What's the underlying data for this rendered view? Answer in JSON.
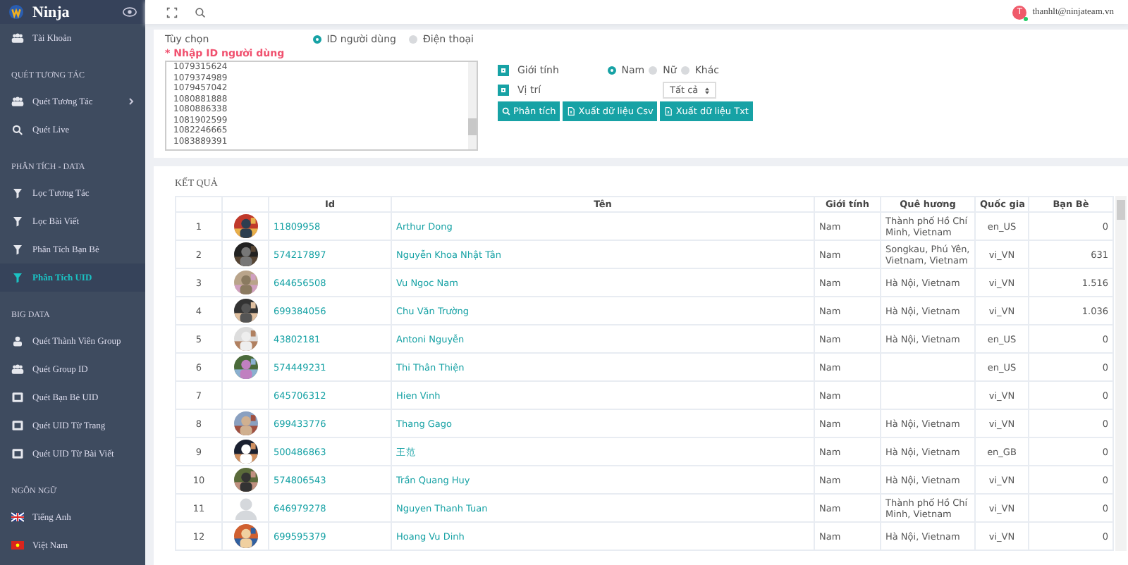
{
  "sidebar": {
    "brand": "Ninja",
    "groups": [
      {
        "items": [
          {
            "label": "Tài Khoản",
            "kind": "users",
            "selected": false,
            "expandable": false
          }
        ]
      },
      {
        "title": "QUÉT TƯƠNG TÁC",
        "items": [
          {
            "label": "Quét Tương Tác",
            "kind": "users",
            "selected": false,
            "expandable": true
          },
          {
            "label": "Quét Live",
            "kind": "search",
            "selected": false,
            "expandable": false
          }
        ]
      },
      {
        "title": "PHÂN TÍCH - DATA",
        "items": [
          {
            "label": "Lọc Tương Tác",
            "kind": "filter",
            "selected": false,
            "expandable": false
          },
          {
            "label": "Lọc Bài Viết",
            "kind": "filter",
            "selected": false,
            "expandable": false
          },
          {
            "label": "Phân Tích Bạn Bè",
            "kind": "filter",
            "selected": false,
            "expandable": false
          },
          {
            "label": "Phân Tích UID",
            "kind": "filter",
            "selected": true,
            "expandable": false
          }
        ]
      },
      {
        "title": "BIG DATA",
        "items": [
          {
            "label": "Quét Thành Viên Group",
            "kind": "user",
            "selected": false,
            "expandable": false
          },
          {
            "label": "Quét Group ID",
            "kind": "users",
            "selected": false,
            "expandable": false
          },
          {
            "label": "Quét Bạn Bè UID",
            "kind": "id",
            "selected": false,
            "expandable": false
          },
          {
            "label": "Quét UID Từ Trang",
            "kind": "id",
            "selected": false,
            "expandable": false
          },
          {
            "label": "Quét UID Từ Bài Viết",
            "kind": "id",
            "selected": false,
            "expandable": false
          }
        ]
      },
      {
        "title": "NGÔN NGỮ",
        "items": [
          {
            "label": "Tiếng Anh",
            "kind": "flag-uk",
            "selected": false,
            "expandable": false
          },
          {
            "label": "Việt Nam",
            "kind": "flag-vn",
            "selected": false,
            "expandable": false
          }
        ]
      }
    ]
  },
  "topbar": {
    "avatar_letter": "T",
    "email": "thanhlt@ninjateam.vn"
  },
  "form": {
    "option_label": "Tùy chọn",
    "id_types": [
      {
        "label": "ID người dùng",
        "selected": true
      },
      {
        "label": "Điện thoại",
        "selected": false
      }
    ],
    "input_label": "* Nhập ID người dùng",
    "input_lines": [
      "1079315624",
      "1079374989",
      "1079457042",
      "1080881888",
      "1080886338",
      "1081902599",
      "1082246665",
      "1083889391"
    ],
    "filters": [
      {
        "label": "Giới tính",
        "checked": true
      },
      {
        "label": "Vị trí",
        "checked": true
      }
    ],
    "genders": [
      {
        "label": "Nam",
        "selected": true
      },
      {
        "label": "Nữ",
        "selected": false
      },
      {
        "label": "Khác",
        "selected": false
      }
    ],
    "location_select": "Tất cả",
    "buttons": [
      {
        "label": "Phân tích",
        "kind": "search"
      },
      {
        "label": "Xuất dữ liệu Csv",
        "kind": "file"
      },
      {
        "label": "Xuất dữ liệu Txt",
        "kind": "file"
      }
    ]
  },
  "results": {
    "title": "KẾT QUẢ",
    "columns": [
      "Id",
      "Tên",
      "Giới tính",
      "Quê hương",
      "Quốc gia",
      "Bạn Bè"
    ],
    "rows": [
      {
        "no": "1",
        "id": "11809958",
        "name": "Arthur Dong",
        "gender": "Nam",
        "hometown": "Thành phố Hồ Chí Minh, Vietnam",
        "country": "en_US",
        "friends": "0"
      },
      {
        "no": "2",
        "id": "574217897",
        "name": "Nguyễn Khoa Nhật Tân",
        "gender": "Nam",
        "hometown": "Songkau, Phú Yên, Vietnam, Vietnam",
        "country": "vi_VN",
        "friends": "631"
      },
      {
        "no": "3",
        "id": "644656508",
        "name": "Vu Ngoc Nam",
        "gender": "Nam",
        "hometown": "Hà Nội, Vietnam",
        "country": "vi_VN",
        "friends": "1.516"
      },
      {
        "no": "4",
        "id": "699384056",
        "name": "Chu Văn Trường",
        "gender": "Nam",
        "hometown": "Hà Nội, Vietnam",
        "country": "vi_VN",
        "friends": "1.036"
      },
      {
        "no": "5",
        "id": "43802181",
        "name": "Antoni Nguyễn",
        "gender": "Nam",
        "hometown": "Hà Nội, Vietnam",
        "country": "en_US",
        "friends": "0"
      },
      {
        "no": "6",
        "id": "574449231",
        "name": "Thi Thân Thiện",
        "gender": "Nam",
        "country": "en_US",
        "friends": "0"
      },
      {
        "no": "7",
        "kind": "none",
        "id": "645706312",
        "name": "Hien Vinh",
        "gender": "Nam",
        "country": "vi_VN",
        "friends": "0"
      },
      {
        "no": "8",
        "id": "699433776",
        "name": "Thang Gago",
        "gender": "Nam",
        "hometown": "Hà Nội, Vietnam",
        "country": "vi_VN",
        "friends": "0"
      },
      {
        "no": "9",
        "id": "500486863",
        "name": "王范",
        "gender": "Nam",
        "hometown": "Hà Nội, Vietnam",
        "country": "en_GB",
        "friends": "0"
      },
      {
        "no": "10",
        "id": "574806543",
        "name": "Trần Quang Huy",
        "gender": "Nam",
        "hometown": "Hà Nội, Vietnam",
        "country": "vi_VN",
        "friends": "0"
      },
      {
        "no": "11",
        "kind": "default",
        "id": "646979278",
        "name": "Nguyen Thanh Tuan",
        "gender": "Nam",
        "hometown": "Thành phố Hồ Chí Minh, Vietnam",
        "country": "vi_VN",
        "friends": "0"
      },
      {
        "no": "12",
        "id": "699595379",
        "name": "Hoang Vu Dinh",
        "gender": "Nam",
        "hometown": "Hà Nội, Vietnam",
        "country": "vi_VN",
        "friends": "0"
      }
    ]
  }
}
